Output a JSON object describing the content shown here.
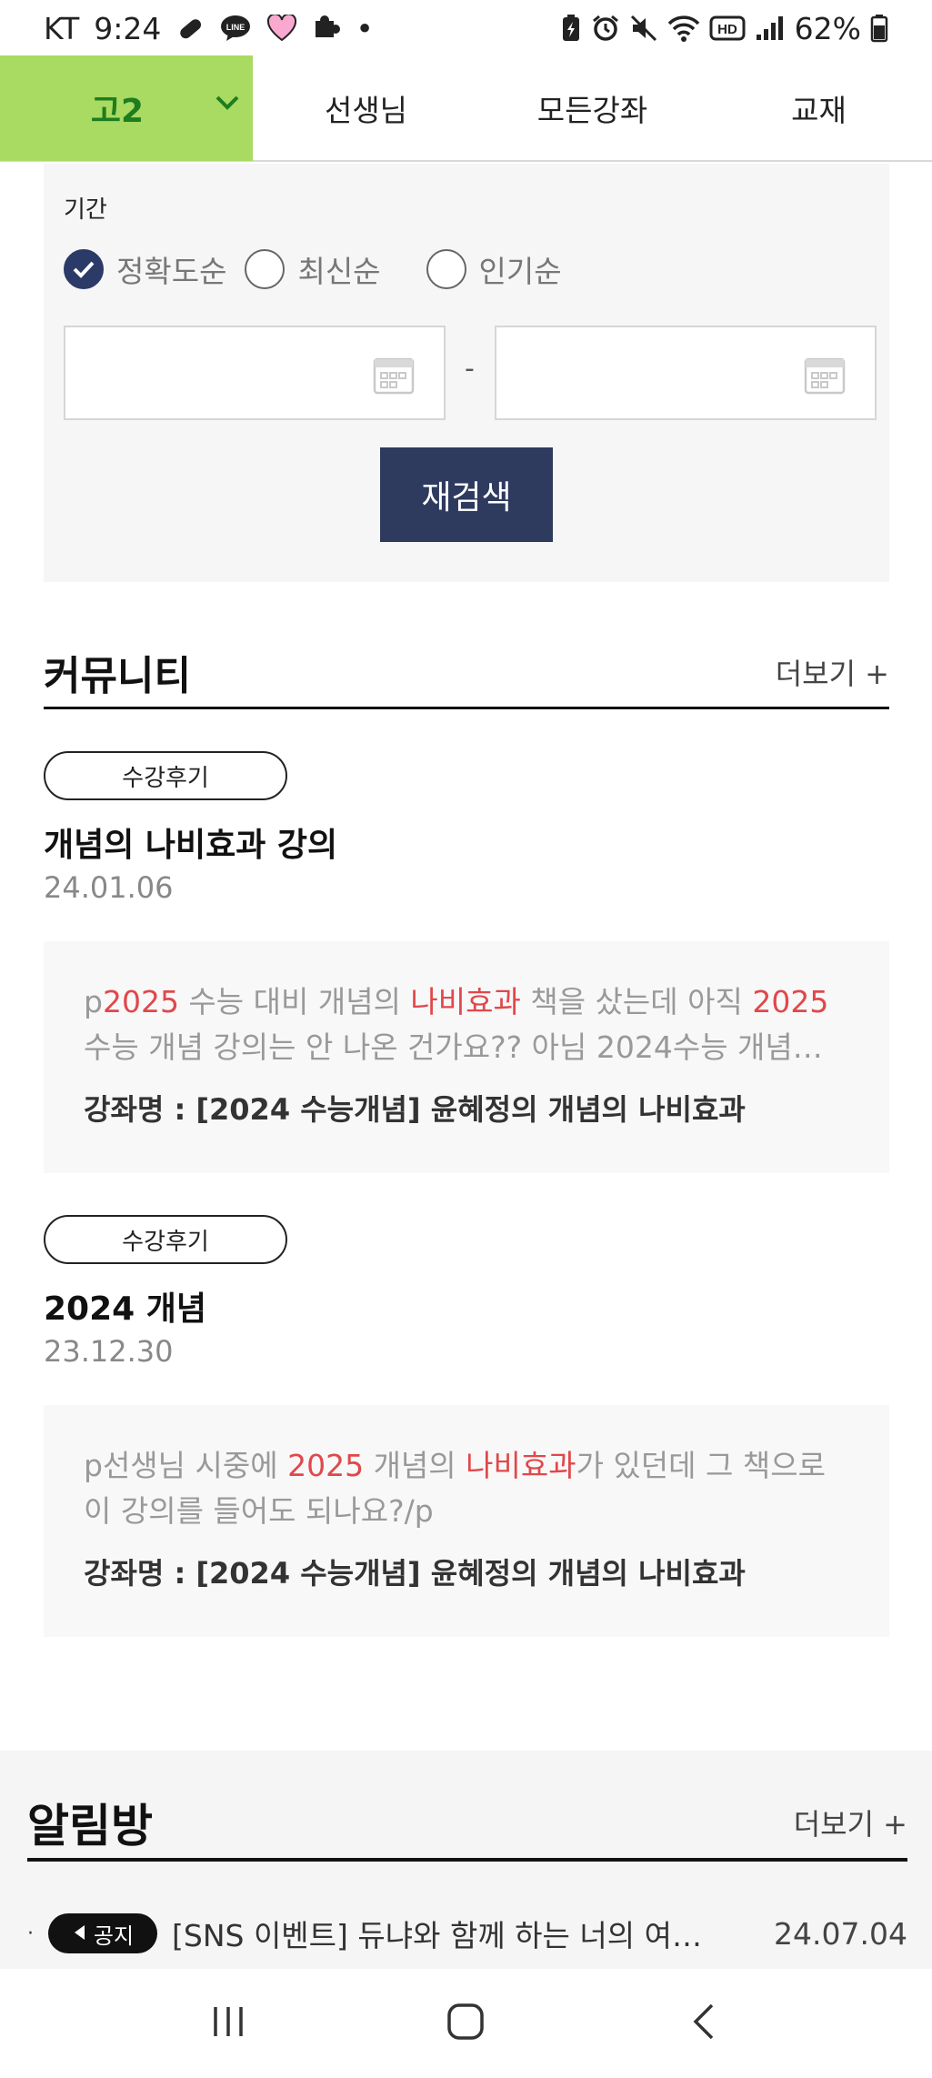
{
  "status_bar": {
    "carrier": "KT",
    "time": "9:24",
    "dot": "•",
    "battery": "62%"
  },
  "top_nav": {
    "grade": "고2",
    "items": [
      "선생님",
      "모든강좌",
      "교재"
    ],
    "accent_color": "#a9da62"
  },
  "filter": {
    "period_label": "기간",
    "sort_options": [
      {
        "label": "정확도순",
        "checked": true
      },
      {
        "label": "최신순",
        "checked": false
      },
      {
        "label": "인기순",
        "checked": false
      }
    ],
    "date_separator": "-",
    "research_label": "재검색"
  },
  "community": {
    "title": "커뮤니티",
    "more": "더보기 +",
    "posts": [
      {
        "tag": "수강후기",
        "title": "개념의 나비효과 강의",
        "date": "24.01.06",
        "excerpt": [
          {
            "t": "p",
            "hl": false
          },
          {
            "t": "2025",
            "hl": true
          },
          {
            "t": " 수능 대비 개념의 ",
            "hl": false
          },
          {
            "t": "나비효과",
            "hl": true
          },
          {
            "t": " 책을 샀는데 아직 ",
            "hl": false
          },
          {
            "t": "2025",
            "hl": true
          },
          {
            "t": " 수능 개념 강의는 안 나온 건가요?? 아님 2024수능 개념…",
            "hl": false
          }
        ],
        "course": "강좌명 : [2024 수능개념] 윤혜정의 개념의 나비효과"
      },
      {
        "tag": "수강후기",
        "title": "2024 개념",
        "date": "23.12.30",
        "excerpt": [
          {
            "t": "p선생님 시중에 ",
            "hl": false
          },
          {
            "t": "2025",
            "hl": true
          },
          {
            "t": " 개념의 ",
            "hl": false
          },
          {
            "t": "나비효과",
            "hl": true
          },
          {
            "t": "가 있던데 그 책으로 이 강의를 들어도 되나요?/p",
            "hl": false
          }
        ],
        "course": "강좌명 : [2024 수능개념] 윤혜정의 개념의 나비효과"
      }
    ]
  },
  "notice": {
    "title": "알림방",
    "more": "더보기 +",
    "items": [
      {
        "bullet": "·",
        "badge": "공지",
        "text": "[SNS 이벤트] 듀냐와 함께 하는 너의 여…",
        "date": "24.07.04"
      }
    ]
  },
  "icons": {
    "grade_chevron": "chevron-down-icon",
    "calendar": "calendar-icon",
    "notice_speaker": "speaker-icon",
    "nav_recents": "recents-icon",
    "nav_home": "home-icon",
    "nav_back": "back-icon"
  }
}
